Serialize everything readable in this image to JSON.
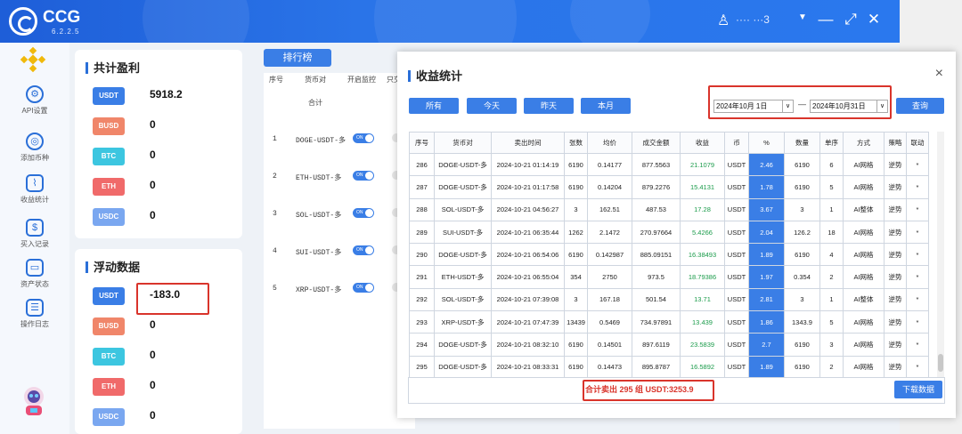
{
  "app": {
    "title": "CCG",
    "version": "6.2.2.5",
    "user_name": "···· ···3",
    "minimize": "—",
    "maximize": "⤢",
    "close": "✕"
  },
  "sidebar": {
    "items": [
      {
        "label": "API设置",
        "icon": "gear-icon"
      },
      {
        "label": "添加币种",
        "icon": "coin-add-icon"
      },
      {
        "label": "收益统计",
        "icon": "chart-icon"
      },
      {
        "label": "买入记录",
        "icon": "record-icon"
      },
      {
        "label": "资产状态",
        "icon": "wallet-icon"
      },
      {
        "label": "操作日志",
        "icon": "log-icon"
      }
    ]
  },
  "profit": {
    "title": "共计盈利",
    "coins": [
      {
        "name": "USDT",
        "value": "5918.2",
        "color": "#3a7ee6"
      },
      {
        "name": "BUSD",
        "value": "0",
        "color": "#f0866a"
      },
      {
        "name": "BTC",
        "value": "0",
        "color": "#3cc6e0"
      },
      {
        "name": "ETH",
        "value": "0",
        "color": "#f06a6a"
      },
      {
        "name": "USDC",
        "value": "0",
        "color": "#7aa7f0"
      }
    ]
  },
  "floating": {
    "title": "浮动数据",
    "coins": [
      {
        "name": "USDT",
        "value": "-183.0",
        "color": "#3a7ee6"
      },
      {
        "name": "BUSD",
        "value": "0",
        "color": "#f0866a"
      },
      {
        "name": "BTC",
        "value": "0",
        "color": "#3cc6e0"
      },
      {
        "name": "ETH",
        "value": "0",
        "color": "#f06a6a"
      },
      {
        "name": "USDC",
        "value": "0",
        "color": "#7aa7f0"
      }
    ]
  },
  "ranking": {
    "button": "排行榜",
    "headers": [
      "序号",
      "货币对",
      "开启监控",
      "只交"
    ],
    "total_label": "合计",
    "rows": [
      {
        "no": "1",
        "pair": "DOGE-USDT-多"
      },
      {
        "no": "2",
        "pair": "ETH-USDT-多"
      },
      {
        "no": "3",
        "pair": "SOL-USDT-多"
      },
      {
        "no": "4",
        "pair": "SUI-USDT-多"
      },
      {
        "no": "5",
        "pair": "XRP-USDT-多"
      }
    ],
    "toggle_label": "ON"
  },
  "dialog": {
    "title": "收益统计",
    "close": "×",
    "filters": [
      "所有",
      "今天",
      "昨天",
      "本月"
    ],
    "date_from": "2024年10月  1日",
    "date_to": "2024年10月31日",
    "date_sep": "—",
    "query": "查询",
    "download": "下载数据",
    "summary": "合计卖出 295 组    USDT:3253.9",
    "headers": [
      "序号",
      "货币对",
      "卖出时间",
      "张数",
      "均价",
      "成交金额",
      "收益",
      "币",
      "%",
      "数量",
      "单序",
      "方式",
      "策略",
      "联动"
    ],
    "rows": [
      [
        "286",
        "DOGE-USDT-多",
        "2024-10-21 01:14:19",
        "6190",
        "0.14177",
        "877.5563",
        "21.1079",
        "USDT",
        "2.46",
        "6190",
        "6",
        "AI网格",
        "逆势",
        "*"
      ],
      [
        "287",
        "DOGE-USDT-多",
        "2024-10-21 01:17:58",
        "6190",
        "0.14204",
        "879.2276",
        "15.4131",
        "USDT",
        "1.78",
        "6190",
        "5",
        "AI网格",
        "逆势",
        "*"
      ],
      [
        "288",
        "SOL-USDT-多",
        "2024-10-21 04:56:27",
        "3",
        "162.51",
        "487.53",
        "17.28",
        "USDT",
        "3.67",
        "3",
        "1",
        "AI整体",
        "逆势",
        "*"
      ],
      [
        "289",
        "SUI-USDT-多",
        "2024-10-21 06:35:44",
        "1262",
        "2.1472",
        "270.97664",
        "5.4266",
        "USDT",
        "2.04",
        "126.2",
        "18",
        "AI网格",
        "逆势",
        "*"
      ],
      [
        "290",
        "DOGE-USDT-多",
        "2024-10-21 06:54:06",
        "6190",
        "0.142987",
        "885.09151",
        "16.38493",
        "USDT",
        "1.89",
        "6190",
        "4",
        "AI网格",
        "逆势",
        "*"
      ],
      [
        "291",
        "ETH-USDT-多",
        "2024-10-21 06:55:04",
        "354",
        "2750",
        "973.5",
        "18.79386",
        "USDT",
        "1.97",
        "0.354",
        "2",
        "AI网格",
        "逆势",
        "*"
      ],
      [
        "292",
        "SOL-USDT-多",
        "2024-10-21 07:39:08",
        "3",
        "167.18",
        "501.54",
        "13.71",
        "USDT",
        "2.81",
        "3",
        "1",
        "AI整体",
        "逆势",
        "*"
      ],
      [
        "293",
        "XRP-USDT-多",
        "2024-10-21 07:47:39",
        "13439",
        "0.5469",
        "734.97891",
        "13.439",
        "USDT",
        "1.86",
        "1343.9",
        "5",
        "AI网格",
        "逆势",
        "*"
      ],
      [
        "294",
        "DOGE-USDT-多",
        "2024-10-21 08:32:10",
        "6190",
        "0.14501",
        "897.6119",
        "23.5839",
        "USDT",
        "2.7",
        "6190",
        "3",
        "AI网格",
        "逆势",
        "*"
      ],
      [
        "295",
        "DOGE-USDT-多",
        "2024-10-21 08:33:31",
        "6190",
        "0.14473",
        "895.8787",
        "16.5892",
        "USDT",
        "1.89",
        "6190",
        "2",
        "AI网格",
        "逆势",
        "*"
      ]
    ]
  }
}
